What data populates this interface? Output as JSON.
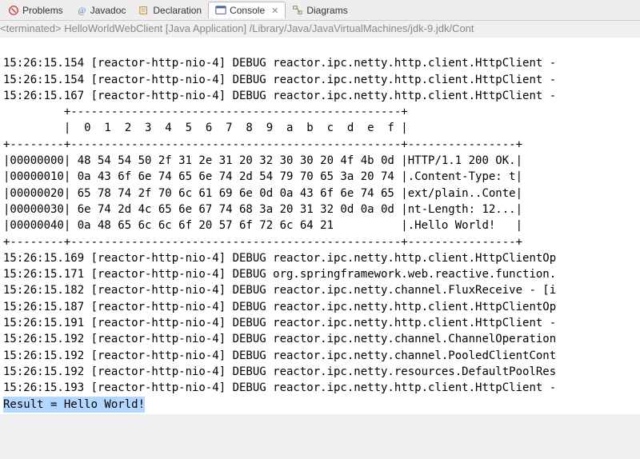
{
  "tabs": [
    {
      "label": "Problems"
    },
    {
      "label": "Javadoc"
    },
    {
      "label": "Declaration"
    },
    {
      "label": "Console"
    },
    {
      "label": "Diagrams"
    }
  ],
  "terminated": "<terminated> HelloWorldWebClient [Java Application] /Library/Java/JavaVirtualMachines/jdk-9.jdk/Cont",
  "log_lines": [
    "15:26:15.154 [reactor-http-nio-4] DEBUG reactor.ipc.netty.http.client.HttpClient - ",
    "15:26:15.154 [reactor-http-nio-4] DEBUG reactor.ipc.netty.http.client.HttpClient - ",
    "15:26:15.167 [reactor-http-nio-4] DEBUG reactor.ipc.netty.http.client.HttpClient - ",
    "         +-------------------------------------------------+",
    "         |  0  1  2  3  4  5  6  7  8  9  a  b  c  d  e  f |",
    "+--------+-------------------------------------------------+----------------+",
    "|00000000| 48 54 54 50 2f 31 2e 31 20 32 30 30 20 4f 4b 0d |HTTP/1.1 200 OK.|",
    "|00000010| 0a 43 6f 6e 74 65 6e 74 2d 54 79 70 65 3a 20 74 |.Content-Type: t|",
    "|00000020| 65 78 74 2f 70 6c 61 69 6e 0d 0a 43 6f 6e 74 65 |ext/plain..Conte|",
    "|00000030| 6e 74 2d 4c 65 6e 67 74 68 3a 20 31 32 0d 0a 0d |nt-Length: 12...|",
    "|00000040| 0a 48 65 6c 6c 6f 20 57 6f 72 6c 64 21          |.Hello World!   |",
    "+--------+-------------------------------------------------+----------------+",
    "15:26:15.169 [reactor-http-nio-4] DEBUG reactor.ipc.netty.http.client.HttpClientOp",
    "15:26:15.171 [reactor-http-nio-4] DEBUG org.springframework.web.reactive.function.",
    "15:26:15.182 [reactor-http-nio-4] DEBUG reactor.ipc.netty.channel.FluxReceive - [i",
    "15:26:15.187 [reactor-http-nio-4] DEBUG reactor.ipc.netty.http.client.HttpClientOp",
    "15:26:15.191 [reactor-http-nio-4] DEBUG reactor.ipc.netty.http.client.HttpClient -",
    "15:26:15.192 [reactor-http-nio-4] DEBUG reactor.ipc.netty.channel.ChannelOperation",
    "15:26:15.192 [reactor-http-nio-4] DEBUG reactor.ipc.netty.channel.PooledClientCont",
    "15:26:15.192 [reactor-http-nio-4] DEBUG reactor.ipc.netty.resources.DefaultPoolRes",
    "15:26:15.193 [reactor-http-nio-4] DEBUG reactor.ipc.netty.http.client.HttpClient -"
  ],
  "result_line": "Result = Hello World!"
}
